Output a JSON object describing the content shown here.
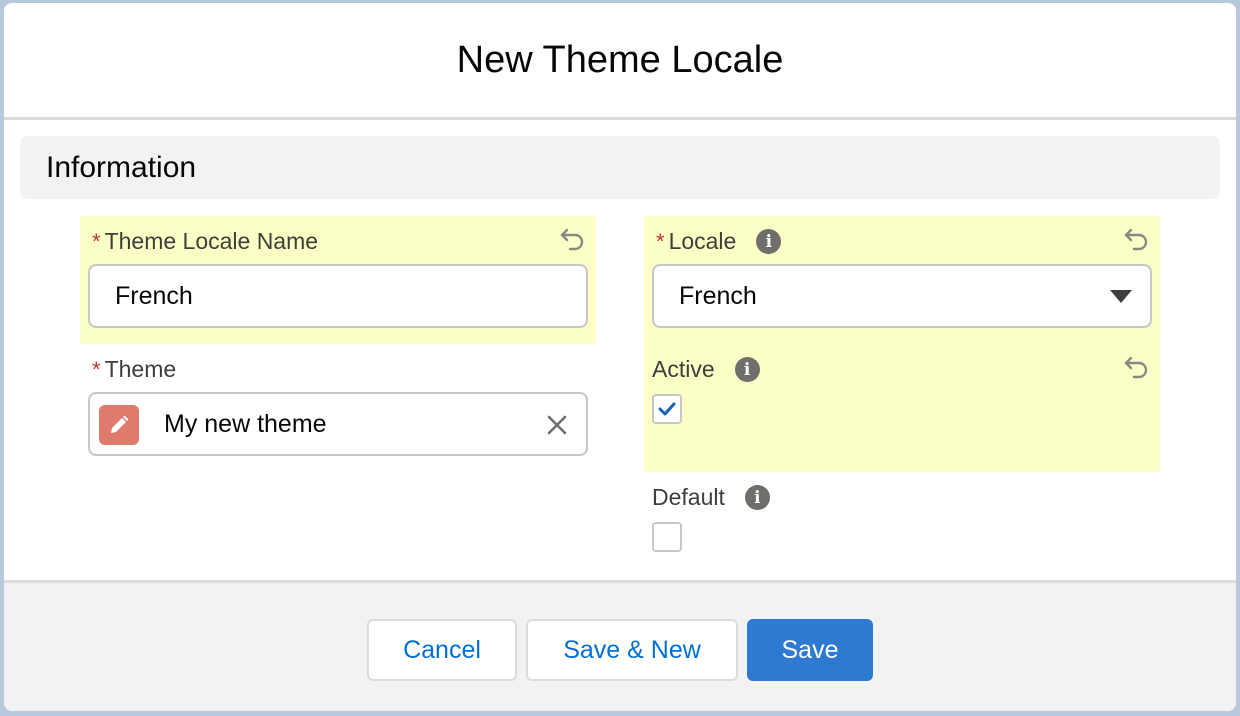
{
  "modal": {
    "title": "New Theme Locale"
  },
  "section": {
    "title": "Information"
  },
  "fields": {
    "theme_locale_name": {
      "label": "Theme Locale Name",
      "required": "*",
      "value": "French"
    },
    "theme": {
      "label": "Theme",
      "required": "*",
      "value": "My new theme",
      "icon": "pencil-icon"
    },
    "locale": {
      "label": "Locale",
      "required": "*",
      "value": "French",
      "info": "i"
    },
    "active": {
      "label": "Active",
      "info": "i",
      "checked": true
    },
    "default": {
      "label": "Default",
      "info": "i",
      "checked": false
    }
  },
  "footer": {
    "cancel_label": "Cancel",
    "save_new_label": "Save & New",
    "save_label": "Save"
  },
  "colors": {
    "highlight": "#fbffc5",
    "brand": "#2e7ad1",
    "required": "#c23934",
    "theme_icon_bg": "#e07a6c"
  }
}
